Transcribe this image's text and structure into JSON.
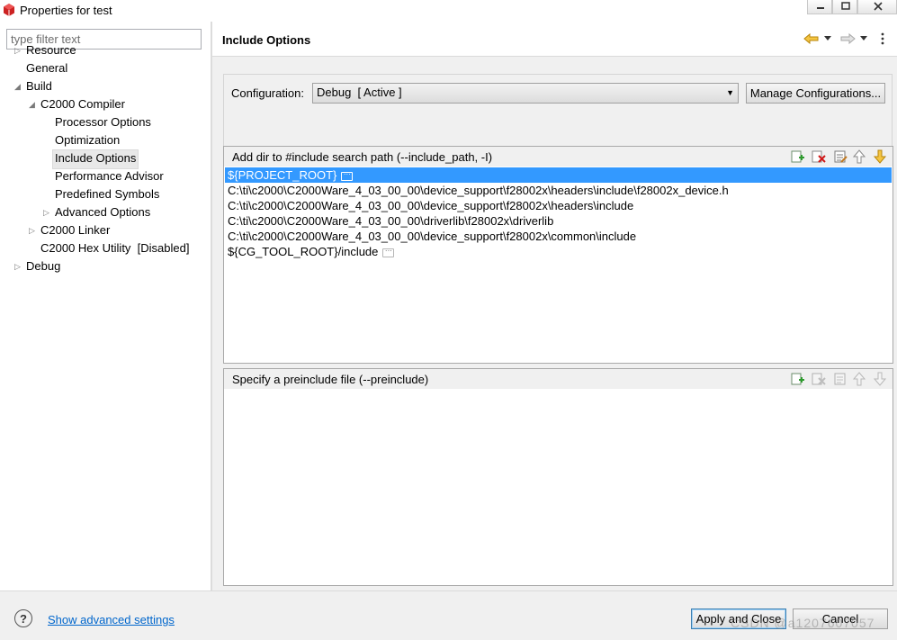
{
  "window": {
    "title": "Properties for test",
    "controls": [
      "minimize-icon",
      "maximize-icon",
      "close-icon"
    ]
  },
  "filter": {
    "placeholder": "type filter text",
    "value": ""
  },
  "tree": [
    {
      "label": "Resource",
      "expander": "collapsed"
    },
    {
      "label": "General",
      "expander": "none"
    },
    {
      "label": "Build",
      "expander": "expanded"
    },
    {
      "label": "C2000 Compiler",
      "expander": "expanded"
    },
    {
      "label": "Processor Options",
      "expander": "none"
    },
    {
      "label": "Optimization",
      "expander": "none"
    },
    {
      "label": "Include Options",
      "expander": "none",
      "selected": true
    },
    {
      "label": "Performance Advisor",
      "expander": "none"
    },
    {
      "label": "Predefined Symbols",
      "expander": "none"
    },
    {
      "label": "Advanced Options",
      "expander": "collapsed"
    },
    {
      "label": "C2000 Linker",
      "expander": "collapsed"
    },
    {
      "label": "C2000 Hex Utility  [Disabled]",
      "expander": "none"
    },
    {
      "label": "Debug",
      "expander": "collapsed"
    }
  ],
  "page": {
    "title": "Include Options",
    "nav_icons": [
      "back-arrow-icon",
      "back-menu-icon",
      "forward-arrow-icon",
      "forward-menu-icon",
      "view-menu-icon"
    ]
  },
  "configuration": {
    "label": "Configuration:",
    "selected": "Debug  [ Active ]",
    "manage_button": "Manage Configurations..."
  },
  "include_paths": {
    "title": "Add dir to #include search path (--include_path, -I)",
    "tools": [
      "add-icon",
      "delete-icon",
      "edit-icon",
      "move-up-icon",
      "move-down-icon"
    ],
    "items": [
      {
        "text": "${PROJECT_ROOT}",
        "selected": true,
        "has_ellipsis": true
      },
      {
        "text": "C:\\ti\\c2000\\C2000Ware_4_03_00_00\\device_support\\f28002x\\headers\\include\\f28002x_device.h",
        "selected": false,
        "has_ellipsis": false
      },
      {
        "text": "C:\\ti\\c2000\\C2000Ware_4_03_00_00\\device_support\\f28002x\\headers\\include",
        "selected": false,
        "has_ellipsis": false
      },
      {
        "text": "C:\\ti\\c2000\\C2000Ware_4_03_00_00\\driverlib\\f28002x\\driverlib",
        "selected": false,
        "has_ellipsis": false
      },
      {
        "text": "C:\\ti\\c2000\\C2000Ware_4_03_00_00\\device_support\\f28002x\\common\\include",
        "selected": false,
        "has_ellipsis": false
      },
      {
        "text": "${CG_TOOL_ROOT}/include",
        "selected": false,
        "has_ellipsis": true
      }
    ],
    "ellipsis_glyph": "···"
  },
  "preinclude": {
    "title": "Specify a preinclude file (--preinclude)",
    "tools": [
      "add-icon",
      "delete-icon",
      "edit-icon",
      "move-up-icon",
      "move-down-icon"
    ],
    "items": []
  },
  "footer": {
    "help_glyph": "?",
    "advanced_link": "Show advanced settings",
    "apply_close": "Apply and Close",
    "cancel": "Cancel"
  },
  "watermark": "CSDN @a1207607057",
  "colors": {
    "selection": "#3399ff",
    "link": "#0066cc",
    "tree_selected_bg": "#e8e8e8"
  }
}
